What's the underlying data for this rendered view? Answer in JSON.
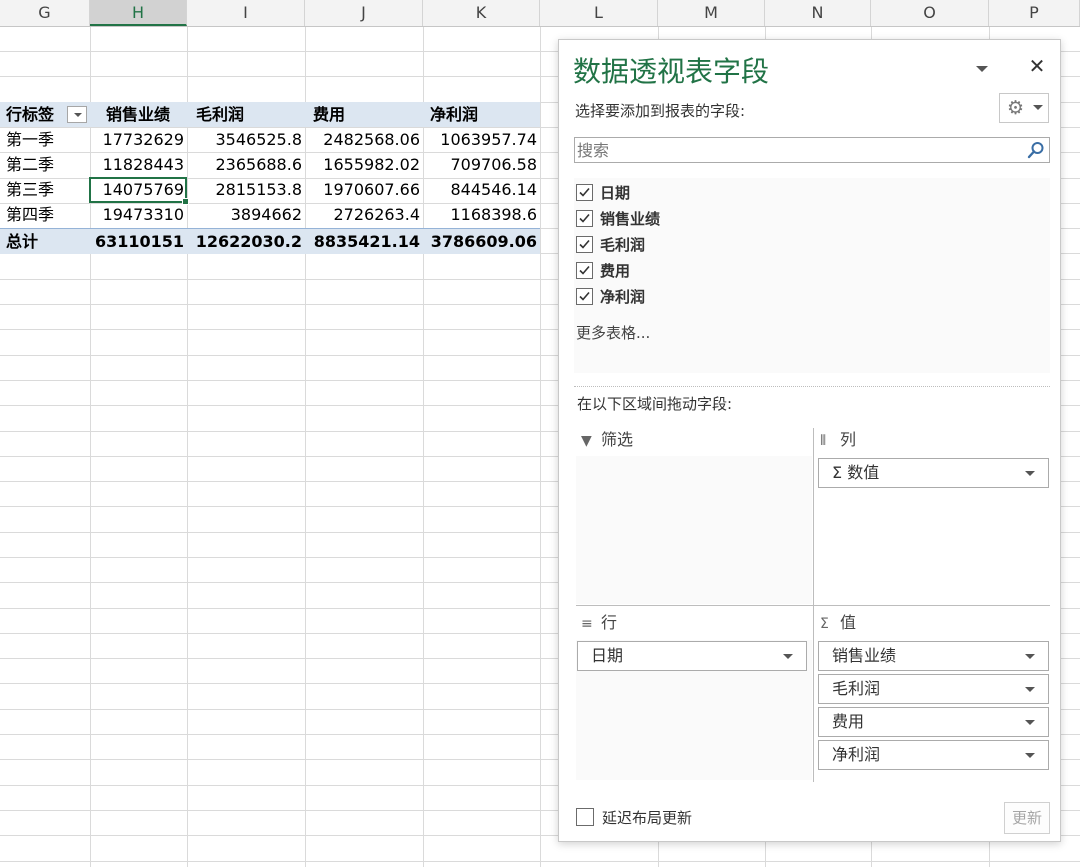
{
  "sheet": {
    "columns": [
      "G",
      "H",
      "I",
      "J",
      "K",
      "L",
      "M",
      "N",
      "O",
      "P"
    ],
    "selected_column": "H"
  },
  "pivot": {
    "header": [
      "行标签",
      "销售业绩",
      "毛利润",
      "费用",
      "净利润"
    ],
    "rows": [
      [
        "第一季",
        "17732629",
        "3546525.8",
        "2482568.06",
        "1063957.74"
      ],
      [
        "第二季",
        "11828443",
        "2365688.6",
        "1655982.02",
        "709706.58"
      ],
      [
        "第三季",
        "14075769",
        "2815153.8",
        "1970607.66",
        "844546.14"
      ],
      [
        "第四季",
        "19473310",
        "3894662",
        "2726263.4",
        "1168398.6"
      ]
    ],
    "total": [
      "总计",
      "63110151",
      "12622030.2",
      "8835421.14",
      "3786609.06"
    ]
  },
  "pane": {
    "title": "数据透视表字段",
    "close_glyph": "✕",
    "choose_label": "选择要添加到报表的字段:",
    "gear_glyph": "⚙",
    "search_placeholder": "搜索",
    "fields": [
      {
        "label": "日期",
        "checked": true
      },
      {
        "label": "销售业绩",
        "checked": true
      },
      {
        "label": "毛利润",
        "checked": true
      },
      {
        "label": "费用",
        "checked": true
      },
      {
        "label": "净利润",
        "checked": true
      }
    ],
    "more_tables": "更多表格...",
    "drag_label": "在以下区域间拖动字段:",
    "areas": {
      "filter": {
        "title": "筛选",
        "icon_glyph": "▼"
      },
      "columns": {
        "title": "列",
        "icon_glyph": "⦀",
        "chips": [
          "Σ 数值"
        ]
      },
      "rows": {
        "title": "行",
        "icon_glyph": "≡",
        "chips": [
          "日期"
        ]
      },
      "values": {
        "title": "值",
        "icon_glyph": "Σ",
        "chips": [
          "销售业绩",
          "毛利润",
          "费用",
          "净利润"
        ]
      }
    },
    "defer_label": "延迟布局更新",
    "update_label": "更新"
  }
}
